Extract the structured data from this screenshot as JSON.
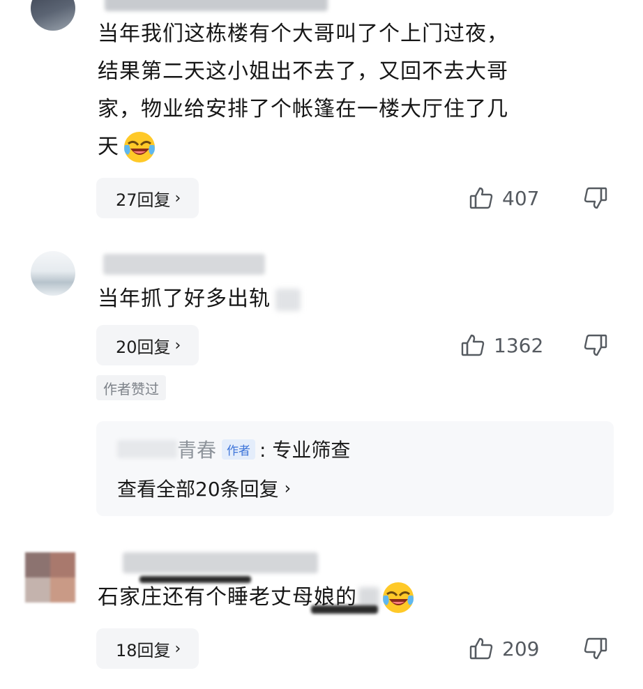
{
  "comments": [
    {
      "text_lines": [
        "当年我们这栋楼有个大哥叫了个上门过夜，",
        "结果第二天这小姐出不去了，又回不去大哥",
        "家，物业给安排了个帐篷在一楼大厅住了几",
        "天"
      ],
      "emoji": "laughing-crying-emoji",
      "reply_label": "27回复",
      "like_count": "407"
    },
    {
      "text": "当年抓了好多出轨",
      "reply_label": "20回复",
      "like_count": "1362",
      "author_liked": "作者赞过",
      "reply_preview": {
        "user_suffix": "青春",
        "author_tag": "作者",
        "text": ": 专业筛查",
        "view_all": "查看全部20条回复"
      }
    },
    {
      "text": "石家庄还有个睡老丈母娘的",
      "emoji": "laughing-crying-emoji",
      "reply_label": "18回复",
      "like_count": "209"
    }
  ],
  "icons": {
    "like": "thumbs-up-icon",
    "dislike": "thumbs-down-icon",
    "chevron": "chevron-right-icon"
  },
  "colors": {
    "text": "#161616",
    "muted": "#555a60",
    "button_bg": "#f4f5f7",
    "author_tag": "#3d74d9"
  }
}
